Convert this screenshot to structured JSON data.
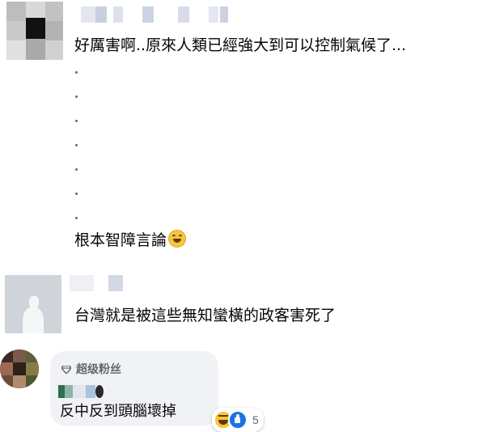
{
  "comments": [
    {
      "text": "好厲害啊..原來人類已經強大到可以控制氣候了...",
      "dots": [
        "·",
        "·",
        "·",
        "·",
        "·",
        "·",
        "·"
      ],
      "tail": "根本智障言論"
    },
    {
      "text": "台灣就是被這些無知蠻橫的政客害死了"
    },
    {
      "badge": "超级粉丝",
      "text": "反中反到頭腦壞掉",
      "reaction_count": "5"
    }
  ],
  "icons": {
    "laugh_emoji": "laughing-face-emoji",
    "fan_badge": "diamond-icon",
    "reactions": [
      "haha-reaction",
      "like-reaction"
    ]
  },
  "colors": {
    "bubble_bg": "#f0f2f5",
    "like_blue": "#1b74e4",
    "secondary_text": "#65676b"
  }
}
